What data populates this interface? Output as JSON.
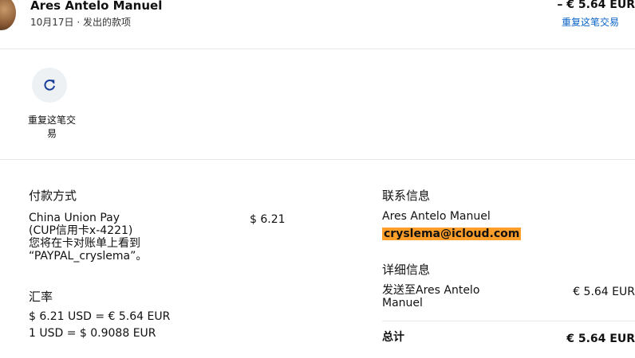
{
  "header": {
    "name": "Ares Antelo Manuel",
    "subtitle": "10月17日 · 发出的款项",
    "amount": "– € 5.64 EUR",
    "repeat_link": "重复这笔交易"
  },
  "actions": {
    "repeat_label": "重复这笔交\n易"
  },
  "payment": {
    "heading": "付款方式",
    "method_lines": [
      "China Union Pay",
      "(CUP信用卡x-4221)",
      "您将在卡对账单上看到",
      "“PAYPAL_cryslema”。"
    ],
    "amount": "$ 6.21"
  },
  "exchange": {
    "heading": "汇率",
    "line1": "$ 6.21 USD = € 5.64 EUR",
    "line2": "1 USD = $ 0.9088 EUR"
  },
  "contact": {
    "heading": "联系信息",
    "name": "Ares Antelo Manuel",
    "email": "cryslema@icloud.com"
  },
  "details": {
    "heading": "详细信息",
    "sent_to_lines": [
      "发送至Ares Antelo",
      "Manuel"
    ],
    "sent_amount": "€ 5.64 EUR",
    "total_label": "总计",
    "total_amount": "€ 5.64 EUR"
  },
  "colors": {
    "link": "#0a63c9",
    "email_highlight": "#ff9f2a",
    "icon": "#1a3f9a"
  },
  "icons": {
    "repeat": "refresh-icon"
  }
}
